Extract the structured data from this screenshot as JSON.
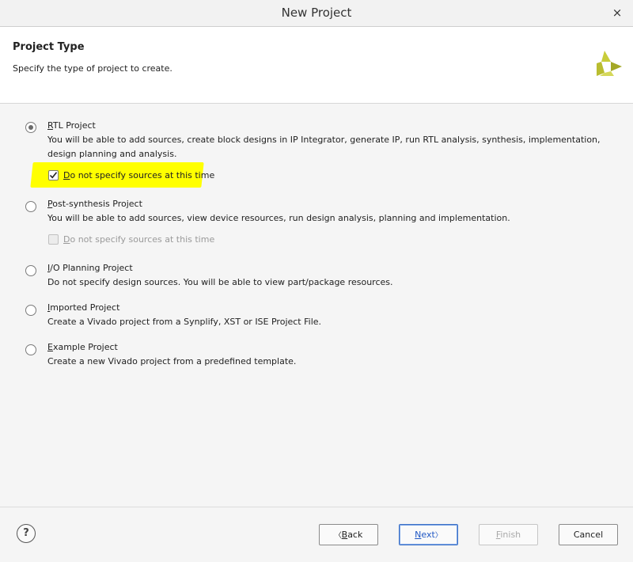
{
  "window": {
    "title": "New Project",
    "close_icon": "×"
  },
  "header": {
    "title": "Project Type",
    "subtitle": "Specify the type of project to create."
  },
  "options": [
    {
      "first": "R",
      "rest": "TL Project",
      "selected": true,
      "desc": "You will be able to add sources, create block designs in IP Integrator, generate IP, run RTL analysis, synthesis, implementation, design planning and analysis.",
      "checkbox": {
        "first": "D",
        "rest": "o not specify sources at this time",
        "checked": true,
        "enabled": true
      }
    },
    {
      "first": "P",
      "rest": "ost-synthesis Project",
      "selected": false,
      "desc": "You will be able to add sources, view device resources, run design analysis, planning and implementation.",
      "checkbox": {
        "first": "D",
        "rest": "o not specify sources at this time",
        "checked": false,
        "enabled": false
      }
    },
    {
      "first": "I",
      "rest": "/O Planning Project",
      "selected": false,
      "desc": "Do not specify design sources. You will be able to view part/package resources."
    },
    {
      "first": "I",
      "rest": "mported Project",
      "selected": false,
      "desc": "Create a Vivado project from a Synplify, XST or ISE Project File."
    },
    {
      "first": "E",
      "rest": "xample Project",
      "selected": false,
      "desc": "Create a new Vivado project from a predefined template."
    }
  ],
  "footer": {
    "help": "?",
    "back_first": "B",
    "back_rest": "ack",
    "back_arrow": "〈",
    "next_first": "N",
    "next_rest": "ext",
    "next_arrow": "〉",
    "finish_first": "F",
    "finish_rest": "inish",
    "cancel": "Cancel"
  },
  "colors": {
    "highlight": "#ffff00",
    "primary_border": "#3f73c7",
    "logo": "#b5b82a"
  }
}
